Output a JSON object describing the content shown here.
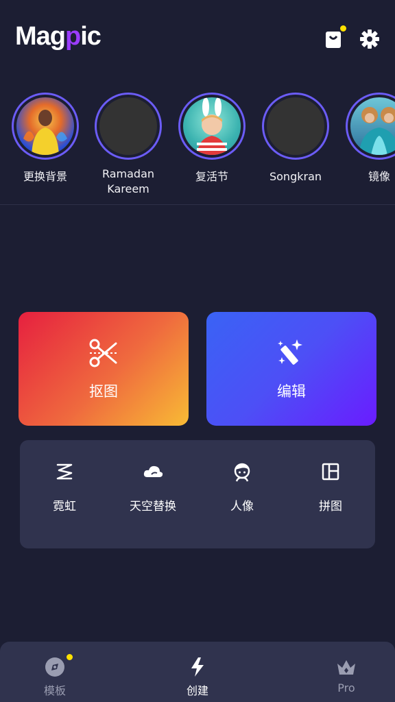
{
  "app": {
    "logo_text_1": "Mag",
    "logo_text_2": "p",
    "logo_text_3": "ic"
  },
  "stories": [
    {
      "label": "更换背景"
    },
    {
      "label": "Ramadan\nKareem"
    },
    {
      "label": "复活节"
    },
    {
      "label": "Songkran"
    },
    {
      "label": "镜像"
    }
  ],
  "cards": {
    "cutout_label": "抠图",
    "edit_label": "编辑"
  },
  "tools": [
    {
      "label": "霓虹"
    },
    {
      "label": "天空替换"
    },
    {
      "label": "人像"
    },
    {
      "label": "拼图"
    }
  ],
  "tabbar": {
    "templates_label": "模板",
    "create_label": "创建",
    "pro_label": "Pro"
  },
  "colors": {
    "background": "#1c1e33",
    "accent_ring": "#6b5cf6",
    "notification_dot": "#ffe100"
  }
}
